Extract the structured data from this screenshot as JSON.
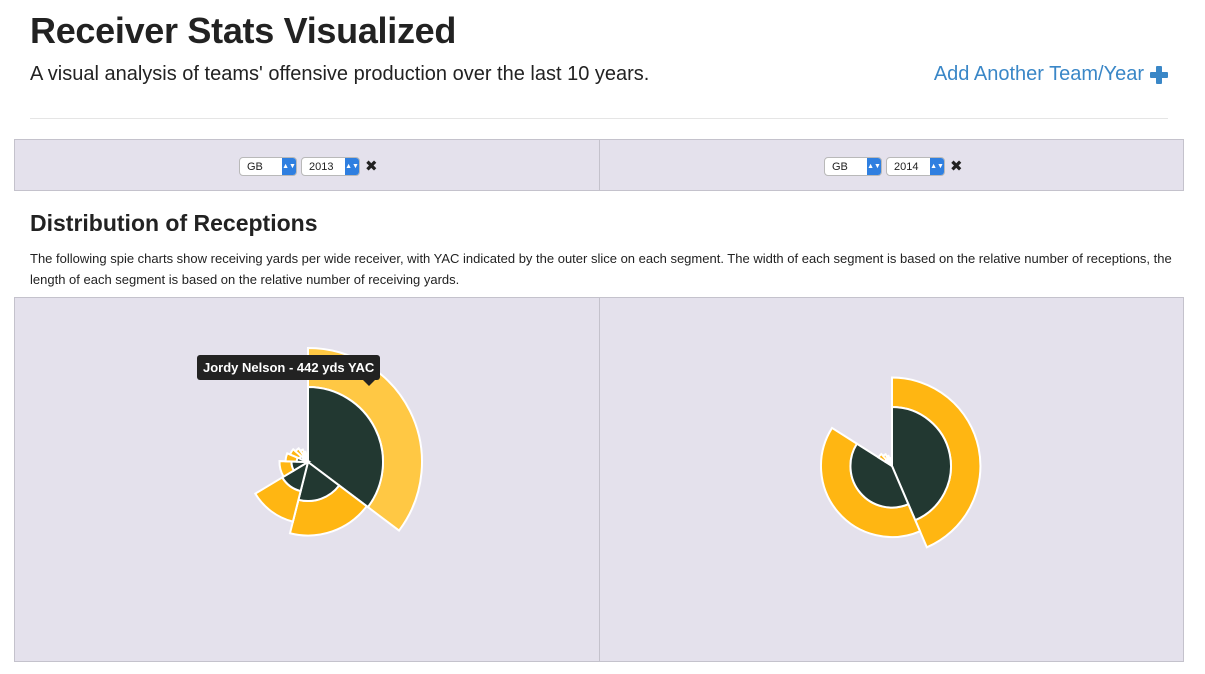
{
  "header": {
    "title": "Receiver Stats Visualized",
    "subtitle": "A visual analysis of teams' offensive production over the last 10 years.",
    "add_label": "Add Another Team/Year"
  },
  "selectors": [
    {
      "team": "GB",
      "year": "2013"
    },
    {
      "team": "GB",
      "year": "2014"
    }
  ],
  "section": {
    "title": "Distribution of Receptions",
    "description": "The following spie charts show receiving yards per wide receiver, with YAC indicated by the outer slice on each segment. The width of each segment is based on the relative number of receptions, the length of each segment is based on the relative number of receiving yards."
  },
  "tooltip": {
    "text": "Jordy Nelson - 442 yds YAC"
  },
  "colors": {
    "air_yards": "#223831",
    "yac": "#ffb612",
    "yac_hover": "#ffc844",
    "panel_bg": "#e4e1ec",
    "link": "#3a87c7"
  },
  "chart_data": [
    {
      "type": "spie",
      "label": "GB 2013",
      "segments": [
        {
          "receptions": 85,
          "inner": 1.0,
          "outer": 1.52,
          "highlighted": true
        },
        {
          "receptions": 45,
          "inner": 0.52,
          "outer": 0.98
        },
        {
          "receptions": 30,
          "inner": 0.4,
          "outer": 0.82
        },
        {
          "receptions": 22,
          "inner": 0.22,
          "outer": 0.38
        },
        {
          "receptions": 14,
          "inner": 0.15,
          "outer": 0.3
        },
        {
          "receptions": 12,
          "inner": 0.12,
          "outer": 0.26
        },
        {
          "receptions": 10,
          "inner": 0.1,
          "outer": 0.22
        },
        {
          "receptions": 8,
          "inner": 0.08,
          "outer": 0.18
        },
        {
          "receptions": 6,
          "inner": 0.06,
          "outer": 0.14
        },
        {
          "receptions": 5,
          "inner": 0.05,
          "outer": 0.1
        },
        {
          "receptions": 4,
          "inner": 0.04,
          "outer": 0.08
        }
      ]
    },
    {
      "type": "spie",
      "label": "GB 2014",
      "segments": [
        {
          "receptions": 98,
          "inner": 0.88,
          "outer": 1.32
        },
        {
          "receptions": 91,
          "inner": 0.62,
          "outer": 1.06
        },
        {
          "receptions": 10,
          "inner": 0.12,
          "outer": 0.24
        },
        {
          "receptions": 8,
          "inner": 0.1,
          "outer": 0.2
        },
        {
          "receptions": 6,
          "inner": 0.08,
          "outer": 0.16
        },
        {
          "receptions": 5,
          "inner": 0.06,
          "outer": 0.12
        },
        {
          "receptions": 4,
          "inner": 0.05,
          "outer": 0.1
        },
        {
          "receptions": 3,
          "inner": 0.04,
          "outer": 0.08
        }
      ]
    }
  ]
}
